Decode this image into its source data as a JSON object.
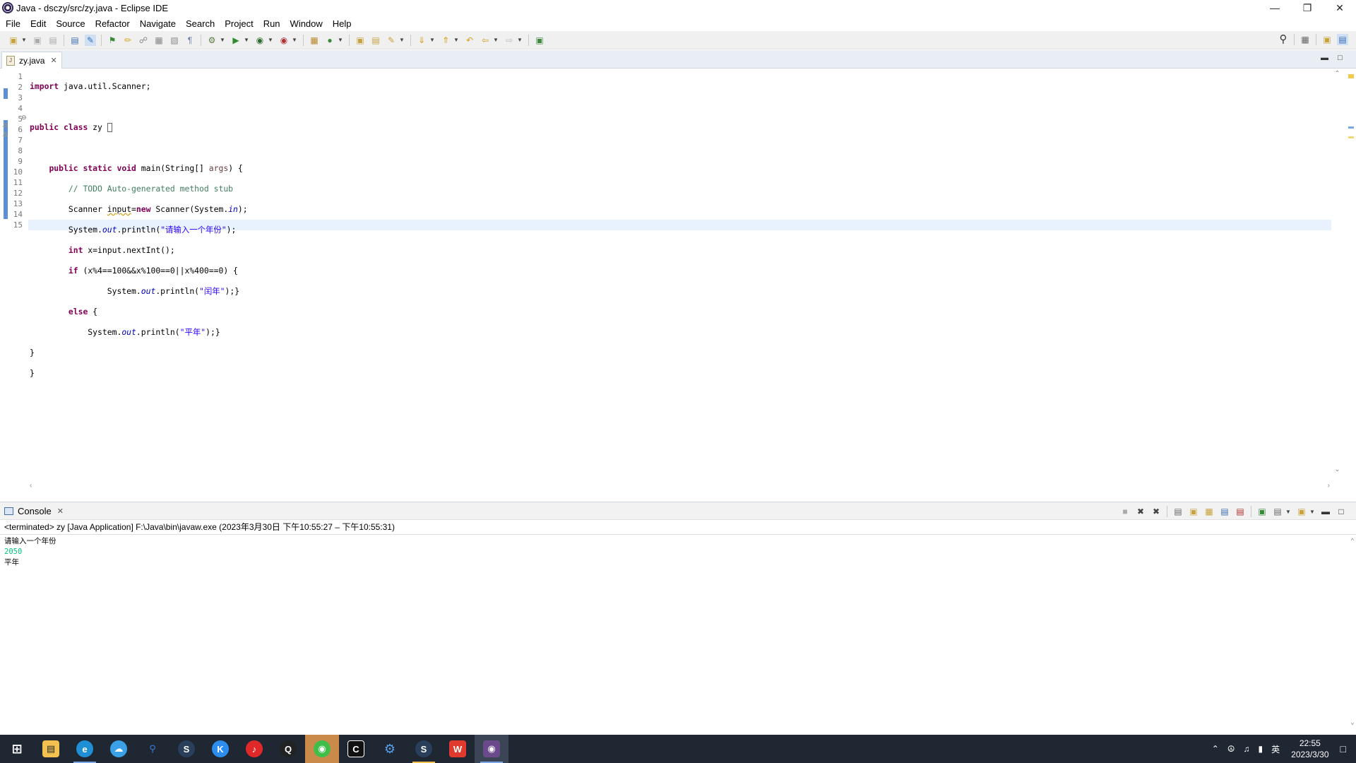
{
  "window": {
    "title": "Java - dsczy/src/zy.java - Eclipse IDE"
  },
  "menu": [
    {
      "label": "File"
    },
    {
      "label": "Edit"
    },
    {
      "label": "Source"
    },
    {
      "label": "Refactor"
    },
    {
      "label": "Navigate"
    },
    {
      "label": "Search"
    },
    {
      "label": "Project"
    },
    {
      "label": "Run"
    },
    {
      "label": "Window"
    },
    {
      "label": "Help"
    }
  ],
  "editor": {
    "tab_label": "zy.java",
    "line_numbers": [
      "1",
      "2",
      "3",
      "4",
      "5",
      "6",
      "7",
      "8",
      "9",
      "10",
      "11",
      "12",
      "13",
      "14",
      "15"
    ]
  },
  "console": {
    "tab_label": "Console",
    "header": "<terminated> zy [Java Application] F:\\Java\\bin\\javaw.exe  (2023年3月30日 下午10:55:27 – 下午10:55:31)",
    "output": [
      {
        "text": "请输入一个年份",
        "type": "out"
      },
      {
        "text": "2050",
        "type": "in"
      },
      {
        "text": "平年",
        "type": "out"
      }
    ]
  },
  "taskbar": {
    "time": "22:55",
    "date": "2023/3/30",
    "ime": "英"
  },
  "colors": {
    "keyword": "#7f0055",
    "comment": "#3f7f5f",
    "string": "#2a00ff",
    "field": "#0000c0",
    "console_input": "#00c87d",
    "taskbar": "#1f2733"
  }
}
